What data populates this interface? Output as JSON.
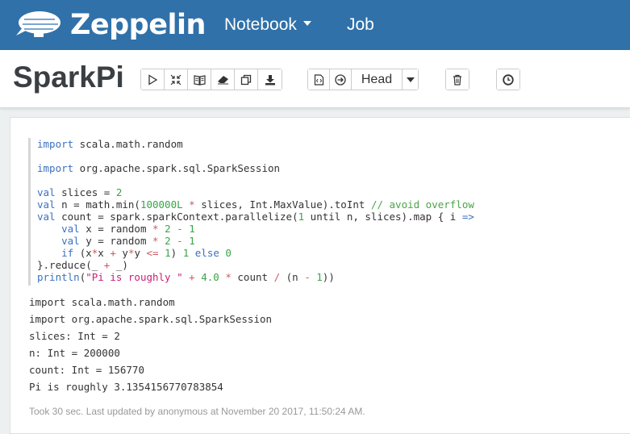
{
  "navbar": {
    "brand": "Zeppelin",
    "menu": [
      {
        "label": "Notebook"
      },
      {
        "label": "Job"
      }
    ]
  },
  "note": {
    "title": "SparkPi",
    "toolbar": {
      "version_label": "Head"
    }
  },
  "paragraph": {
    "code_lines": [
      "import scala.math.random",
      "",
      "import org.apache.spark.sql.SparkSession",
      "",
      "val slices = 2",
      "val n = math.min(100000L * slices, Int.MaxValue).toInt // avoid overflow",
      "val count = spark.sparkContext.parallelize(1 until n, slices).map { i =>",
      "    val x = random * 2 - 1",
      "    val y = random * 2 - 1",
      "    if (x*x + y*y <= 1) 1 else 0",
      "}.reduce(_ + _)",
      "println(\"Pi is roughly \" + 4.0 * count / (n - 1))"
    ],
    "output_lines": [
      "import scala.math.random",
      "import org.apache.spark.sql.SparkSession",
      "slices: Int = 2",
      "n: Int = 200000",
      "count: Int = 156770",
      "Pi is roughly 3.1354156770783854"
    ],
    "footer": "Took 30 sec. Last updated by anonymous at November 20 2017, 11:50:24 AM."
  },
  "colors": {
    "navbar": "#3071a9",
    "keyword": "#3b71c1",
    "number": "#38a548",
    "string": "#c81e78",
    "comment": "#4aa647"
  }
}
